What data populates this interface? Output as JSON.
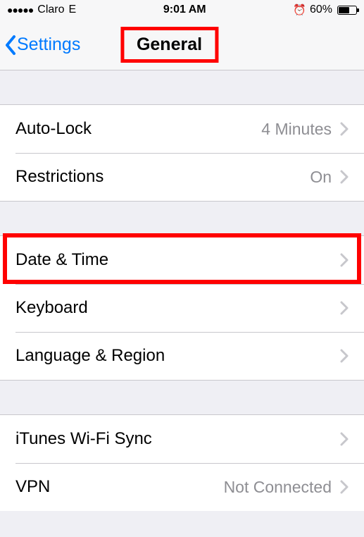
{
  "status_bar": {
    "signal_dots": "●●●●●",
    "carrier": "Claro",
    "network_type": "E",
    "time": "9:01 AM",
    "alarm_glyph": "⏰",
    "battery_percent": "60%"
  },
  "nav": {
    "back_label": "Settings",
    "title": "General"
  },
  "groups": [
    {
      "rows": [
        {
          "label": "Auto-Lock",
          "value": "4 Minutes"
        },
        {
          "label": "Restrictions",
          "value": "On"
        }
      ]
    },
    {
      "rows": [
        {
          "label": "Date & Time",
          "value": ""
        },
        {
          "label": "Keyboard",
          "value": ""
        },
        {
          "label": "Language & Region",
          "value": ""
        }
      ]
    },
    {
      "rows": [
        {
          "label": "iTunes Wi-Fi Sync",
          "value": ""
        },
        {
          "label": "VPN",
          "value": "Not Connected"
        }
      ]
    }
  ],
  "highlights": {
    "title": true,
    "date_time": true
  }
}
